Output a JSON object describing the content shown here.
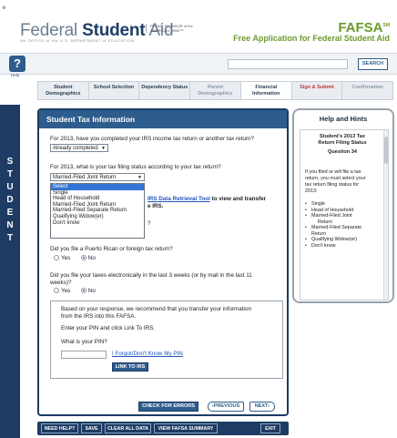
{
  "header": {
    "corner": "e",
    "brand_light": "Federal ",
    "brand_bold": "Student",
    "brand_light2": " Aid",
    "brand_sub": "AN OFFICE of the U.S. DEPARTMENT of EDUCATION",
    "sponsor": "PROUD SPONSOR of the AMERICAN MIND™",
    "fafsa": "FAFSA",
    "fafsa_sm": "SM",
    "tagline": "Free Application for Federal Student Aid"
  },
  "helpbar": {
    "help_icon": "?",
    "help_label": "Help",
    "search_label": "SEARCH"
  },
  "nav": {
    "tabs": [
      {
        "label": "Student Demographics",
        "state": "normal"
      },
      {
        "label": "School Selection",
        "state": "normal"
      },
      {
        "label": "Dependency Status",
        "state": "normal"
      },
      {
        "label": "Parent Demographics",
        "state": "dim"
      },
      {
        "label": "Financial Information",
        "state": "active"
      },
      {
        "label": "Sign & Submit",
        "state": "sign"
      },
      {
        "label": "Confirmation",
        "state": "dim"
      }
    ]
  },
  "sidebar": {
    "letters": [
      "S",
      "T",
      "U",
      "D",
      "E",
      "N",
      "T"
    ]
  },
  "main": {
    "title": "Student Tax Information",
    "q1": "For 2013, have you completed your IRS income tax return or another tax return?",
    "q1_value": "Already completed",
    "q2": "For 2013, what is your tax filing status according to your tax return?",
    "q2_value": "Married-Filed Joint Return",
    "dropdown_options": [
      "Select",
      "Single",
      "Head of Household",
      "Married-Filed Joint Return",
      "Married-Filed Separate Return",
      "Qualifying Widow(er)",
      "Don't know"
    ],
    "drt_link": "IRS Data Retrieval Tool",
    "drt_text": " to view and transfer",
    "drt_text2": "e IRS.",
    "hidden_q_mark": "?",
    "q3": "Did you file a Puerto Rican or foreign tax return?",
    "yes": "Yes",
    "no": "No",
    "q4a": "Did you file your taxes electronically in the last 3 weeks (or by mail in the last 11",
    "q4b": "weeks)?",
    "box_line1": "Based on your response, we recommend that you transfer your information",
    "box_line2": "from the IRS into this FAFSA.",
    "box_line3": "Enter your PIN and click Link To IRS.",
    "pin_label": "What is your PIN?",
    "forgot_pin": "I Forgot/Don't Know My PIN",
    "link_to_irs": "LINK TO IRS",
    "check_errors": "CHECK FOR ERRORS",
    "previous": "PREVIOUS",
    "next": "NEXT"
  },
  "bottom": {
    "need_help": "NEED HELP?",
    "save": "SAVE",
    "clear_all": "CLEAR ALL DATA",
    "view_summary": "VIEW FAFSA SUMMARY",
    "exit": "EXIT"
  },
  "hints": {
    "title": "Help and Hints",
    "subtitle1": "Student's 2013 Tax",
    "subtitle2": "Return Filing Status",
    "question": "Question 34",
    "para1": "If you filed or will file a tax",
    "para2": "return, you must select your",
    "para3": "tax return filing status for",
    "para4": "2013:",
    "items": [
      "Single",
      "Head of Household",
      "Married-Filed Joint",
      "Return",
      "Married-Filed Separate",
      "Return",
      "Qualifying Widow(er)",
      "Don't know"
    ]
  }
}
